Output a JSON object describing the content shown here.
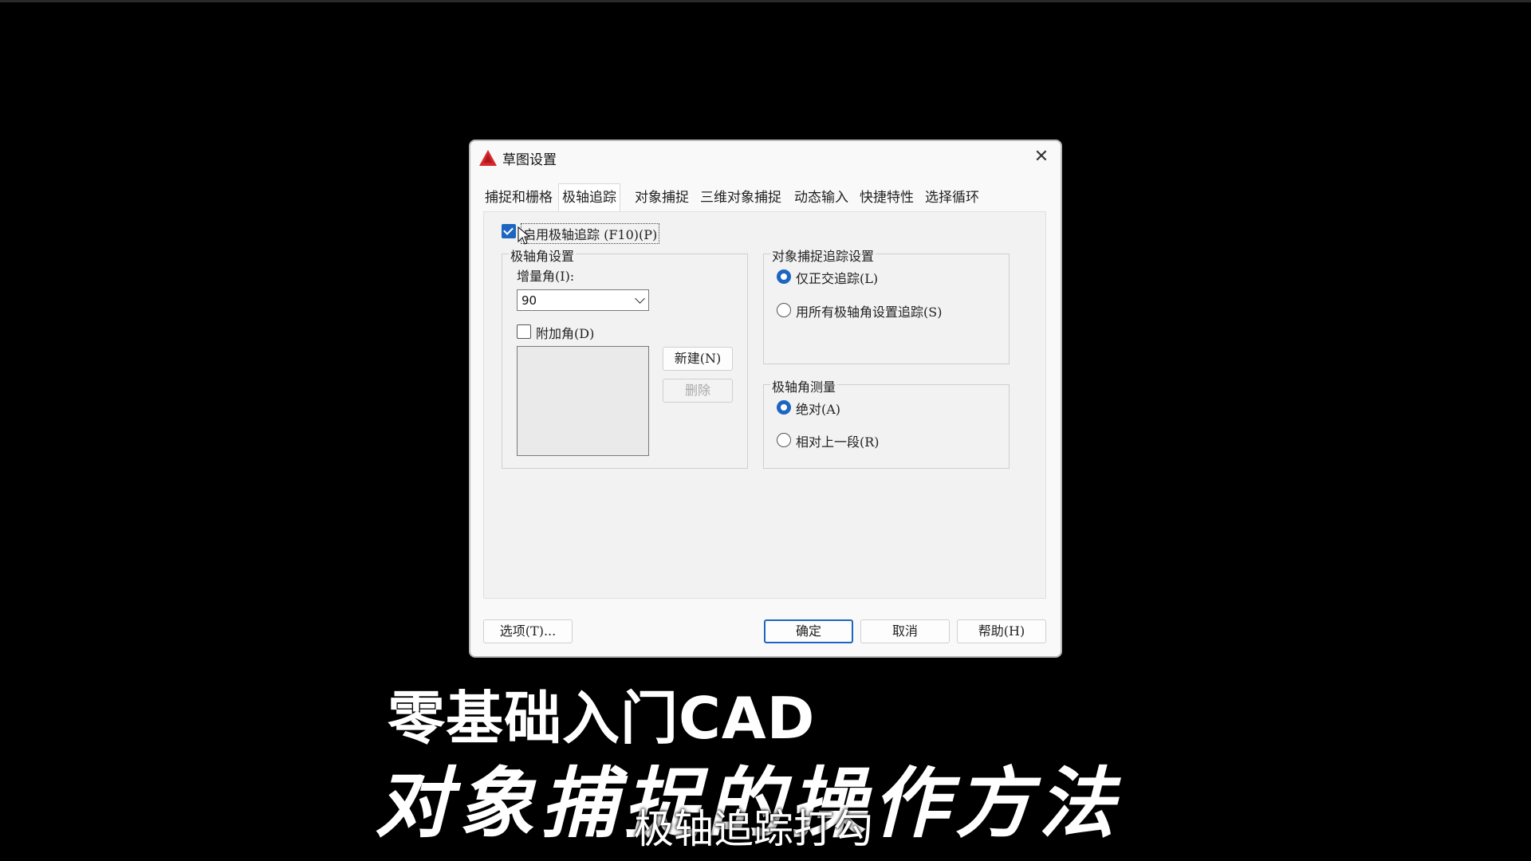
{
  "dialog": {
    "title": "草图设置",
    "close_label": "✕",
    "tabs": [
      "捕捉和栅格",
      "极轴追踪",
      "对象捕捉",
      "三维对象捕捉",
      "动态输入",
      "快捷特性",
      "选择循环"
    ],
    "active_tab": "极轴追踪"
  },
  "polar": {
    "enable_label": "启用极轴追踪 (F10)(P)",
    "enable_checked": true,
    "angle_group_title": "极轴角设置",
    "increment_label": "增量角(I):",
    "increment_value": "90",
    "additional_label": "附加角(D)",
    "additional_checked": false,
    "new_button": "新建(N)",
    "delete_button": "删除"
  },
  "osnap_tracking": {
    "group_title": "对象捕捉追踪设置",
    "options": [
      "仅正交追踪(L)",
      "用所有极轴角设置追踪(S)"
    ],
    "selected": 0
  },
  "measure": {
    "group_title": "极轴角测量",
    "options": [
      "绝对(A)",
      "相对上一段(R)"
    ],
    "selected": 0
  },
  "footer": {
    "options_button": "选项(T)...",
    "ok_button": "确定",
    "cancel_button": "取消",
    "help_button": "帮助(H)"
  },
  "overlay": {
    "line1": "零基础入门CAD",
    "line2": "对象捕捉的操作方法",
    "subtitle": "极轴追踪打勾"
  },
  "colors": {
    "accent": "#1c66c2",
    "logo": "#d6282b",
    "background": "#000000"
  }
}
